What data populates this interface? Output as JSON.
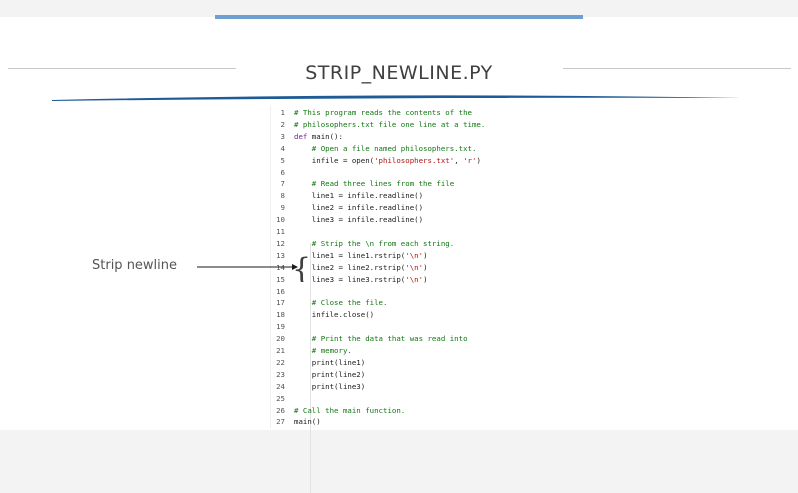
{
  "slide": {
    "title": "STRIP_NEWLINE.PY",
    "annotation": "Strip newline"
  },
  "code": [
    {
      "n": "1",
      "t": "# This program reads the contents of the",
      "k": "comment"
    },
    {
      "n": "2",
      "t": "# philosophers.txt file one line at a time.",
      "k": "comment"
    },
    {
      "n": "3",
      "t": "def main():",
      "k": "def"
    },
    {
      "n": "4",
      "t": "    # Open a file named philosophers.txt.",
      "k": "comment"
    },
    {
      "n": "5",
      "t": "    infile = open('philosophers.txt', 'r')",
      "k": "open"
    },
    {
      "n": "6",
      "t": "",
      "k": "plain"
    },
    {
      "n": "7",
      "t": "    # Read three lines from the file",
      "k": "comment"
    },
    {
      "n": "8",
      "t": "    line1 = infile.readline()",
      "k": "plain"
    },
    {
      "n": "9",
      "t": "    line2 = infile.readline()",
      "k": "plain"
    },
    {
      "n": "10",
      "t": "    line3 = infile.readline()",
      "k": "plain"
    },
    {
      "n": "11",
      "t": "",
      "k": "plain"
    },
    {
      "n": "12",
      "t": "    # Strip the \\n from each string.",
      "k": "comment"
    },
    {
      "n": "13",
      "t": "    line1 = line1.rstrip('\\n')",
      "k": "rstrip"
    },
    {
      "n": "14",
      "t": "    line2 = line2.rstrip('\\n')",
      "k": "rstrip"
    },
    {
      "n": "15",
      "t": "    line3 = line3.rstrip('\\n')",
      "k": "rstrip"
    },
    {
      "n": "16",
      "t": "",
      "k": "plain"
    },
    {
      "n": "17",
      "t": "    # Close the file.",
      "k": "comment"
    },
    {
      "n": "18",
      "t": "    infile.close()",
      "k": "plain"
    },
    {
      "n": "19",
      "t": "",
      "k": "plain"
    },
    {
      "n": "20",
      "t": "    # Print the data that was read into",
      "k": "comment"
    },
    {
      "n": "21",
      "t": "    # memory.",
      "k": "comment"
    },
    {
      "n": "22",
      "t": "    print(line1)",
      "k": "plain"
    },
    {
      "n": "23",
      "t": "    print(line2)",
      "k": "plain"
    },
    {
      "n": "24",
      "t": "    print(line3)",
      "k": "plain"
    },
    {
      "n": "25",
      "t": "",
      "k": "plain"
    },
    {
      "n": "26",
      "t": "# Call the main function.",
      "k": "comment"
    },
    {
      "n": "27",
      "t": "main()",
      "k": "plain"
    }
  ],
  "colors": {
    "comment": "#117711",
    "keyword": "#7a1f9a",
    "string": "#b31212",
    "accent": "#6e9fd3",
    "title_bar": "#1f5b96"
  }
}
